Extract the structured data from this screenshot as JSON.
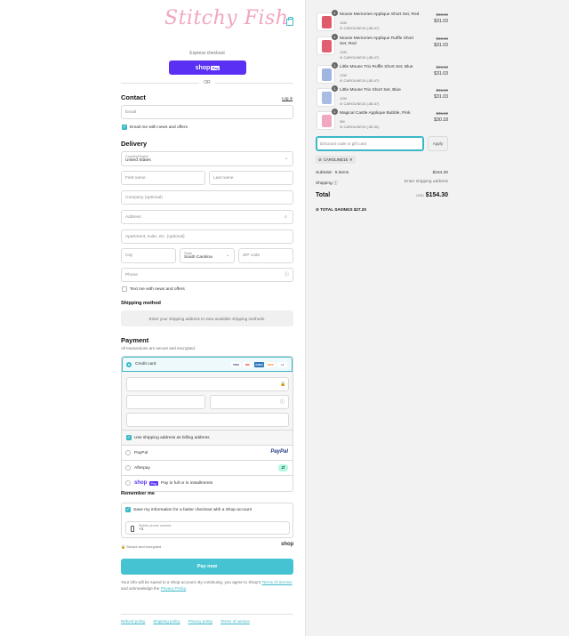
{
  "brand": {
    "logo_text": "Stitchy Fish",
    "accent": "#3cb8c9",
    "shop_pay_color": "#5a31f4"
  },
  "express": {
    "label": "Express checkout",
    "button_text": "shop",
    "button_badge": "Pay",
    "or": "OR"
  },
  "contact": {
    "heading": "Contact",
    "login": "Log in",
    "email_placeholder": "Email",
    "news_label": "Email me with news and offers"
  },
  "delivery": {
    "heading": "Delivery",
    "country_label": "Country/Region",
    "country_value": "United States",
    "first_name": "First name",
    "last_name": "Last name",
    "company": "Company (optional)",
    "address": "Address",
    "apartment": "Apartment, suite, etc. (optional)",
    "city": "City",
    "state_label": "State",
    "state_value": "South Carolina",
    "zip": "ZIP code",
    "phone": "Phone",
    "text_label": "Text me with news and offers"
  },
  "shipping": {
    "heading": "Shipping method",
    "message": "Enter your shipping address to view available shipping methods."
  },
  "payment": {
    "heading": "Payment",
    "subtitle": "All transactions are secure and encrypted.",
    "credit_card": "Credit card",
    "cards": [
      "VISA",
      "MC",
      "AMEX",
      "DISC",
      "+4"
    ],
    "billing_label": "Use shipping address as billing address",
    "paypal": "PayPal",
    "paypal_logo": "PayPal",
    "afterpay": "Afterpay",
    "shop_logo": "shop",
    "shop_badge": "Pay",
    "shop_pay_text": "Pay in full or in installments"
  },
  "remember": {
    "heading": "Remember me",
    "save_label": "Save my information for a faster checkout with a Shop account",
    "phone_label": "Mobile phone number",
    "phone_value": "+1",
    "secure": "Secure and encrypted",
    "shop_text": "shop"
  },
  "pay_now": "Pay now",
  "disclaimer": {
    "text_1": "Your info will be saved to a Shop account. By continuing, you agree to Shop's ",
    "terms": "Terms of Service",
    "text_2": " and acknowledge the ",
    "privacy": "Privacy Policy",
    "text_3": "."
  },
  "footer_links": [
    "Refund policy",
    "Shipping policy",
    "Privacy policy",
    "Terms of service"
  ],
  "cart": {
    "items": [
      {
        "name": "Mouse Memories Applique Short Set, Red",
        "size": "12M",
        "code": "CAROLINE15 (-$5.47)",
        "old": "$36.50",
        "new": "$31.03",
        "qty": "1",
        "color": "#e05a6a"
      },
      {
        "name": "Mouse Memories Applique Ruffle Short Set, Red",
        "size": "12M",
        "code": "CAROLINE15 (-$5.47)",
        "old": "$36.50",
        "new": "$31.03",
        "qty": "1",
        "color": "#e06070"
      },
      {
        "name": "Little Mouse Trio Ruffle Short Set, Blue",
        "size": "12M",
        "code": "CAROLINE15 (-$5.47)",
        "old": "$36.50",
        "new": "$31.03",
        "qty": "1",
        "color": "#9fb7e0"
      },
      {
        "name": "Little Mouse Trio Short Set, Blue",
        "size": "12M",
        "code": "CAROLINE15 (-$5.47)",
        "old": "$36.50",
        "new": "$31.03",
        "qty": "1",
        "color": "#a7bde3"
      },
      {
        "name": "Magical Castle Applique Bubble, Pink",
        "size": "3M",
        "code": "CAROLINE15 (-$5.32)",
        "old": "$35.50",
        "new": "$30.18",
        "qty": "1",
        "color": "#f0a8bf"
      }
    ],
    "discount_placeholder": "Discount code or gift card",
    "apply": "Apply",
    "applied_code": "CAROLINE15",
    "subtotal_label": "Subtotal · 5 items",
    "subtotal_value": "$154.30",
    "shipping_label": "Shipping",
    "shipping_value": "Enter shipping address",
    "total_label": "Total",
    "currency": "USD",
    "total_value": "$154.30",
    "savings_label": "TOTAL SAVINGS",
    "savings_value": "$27.20"
  }
}
